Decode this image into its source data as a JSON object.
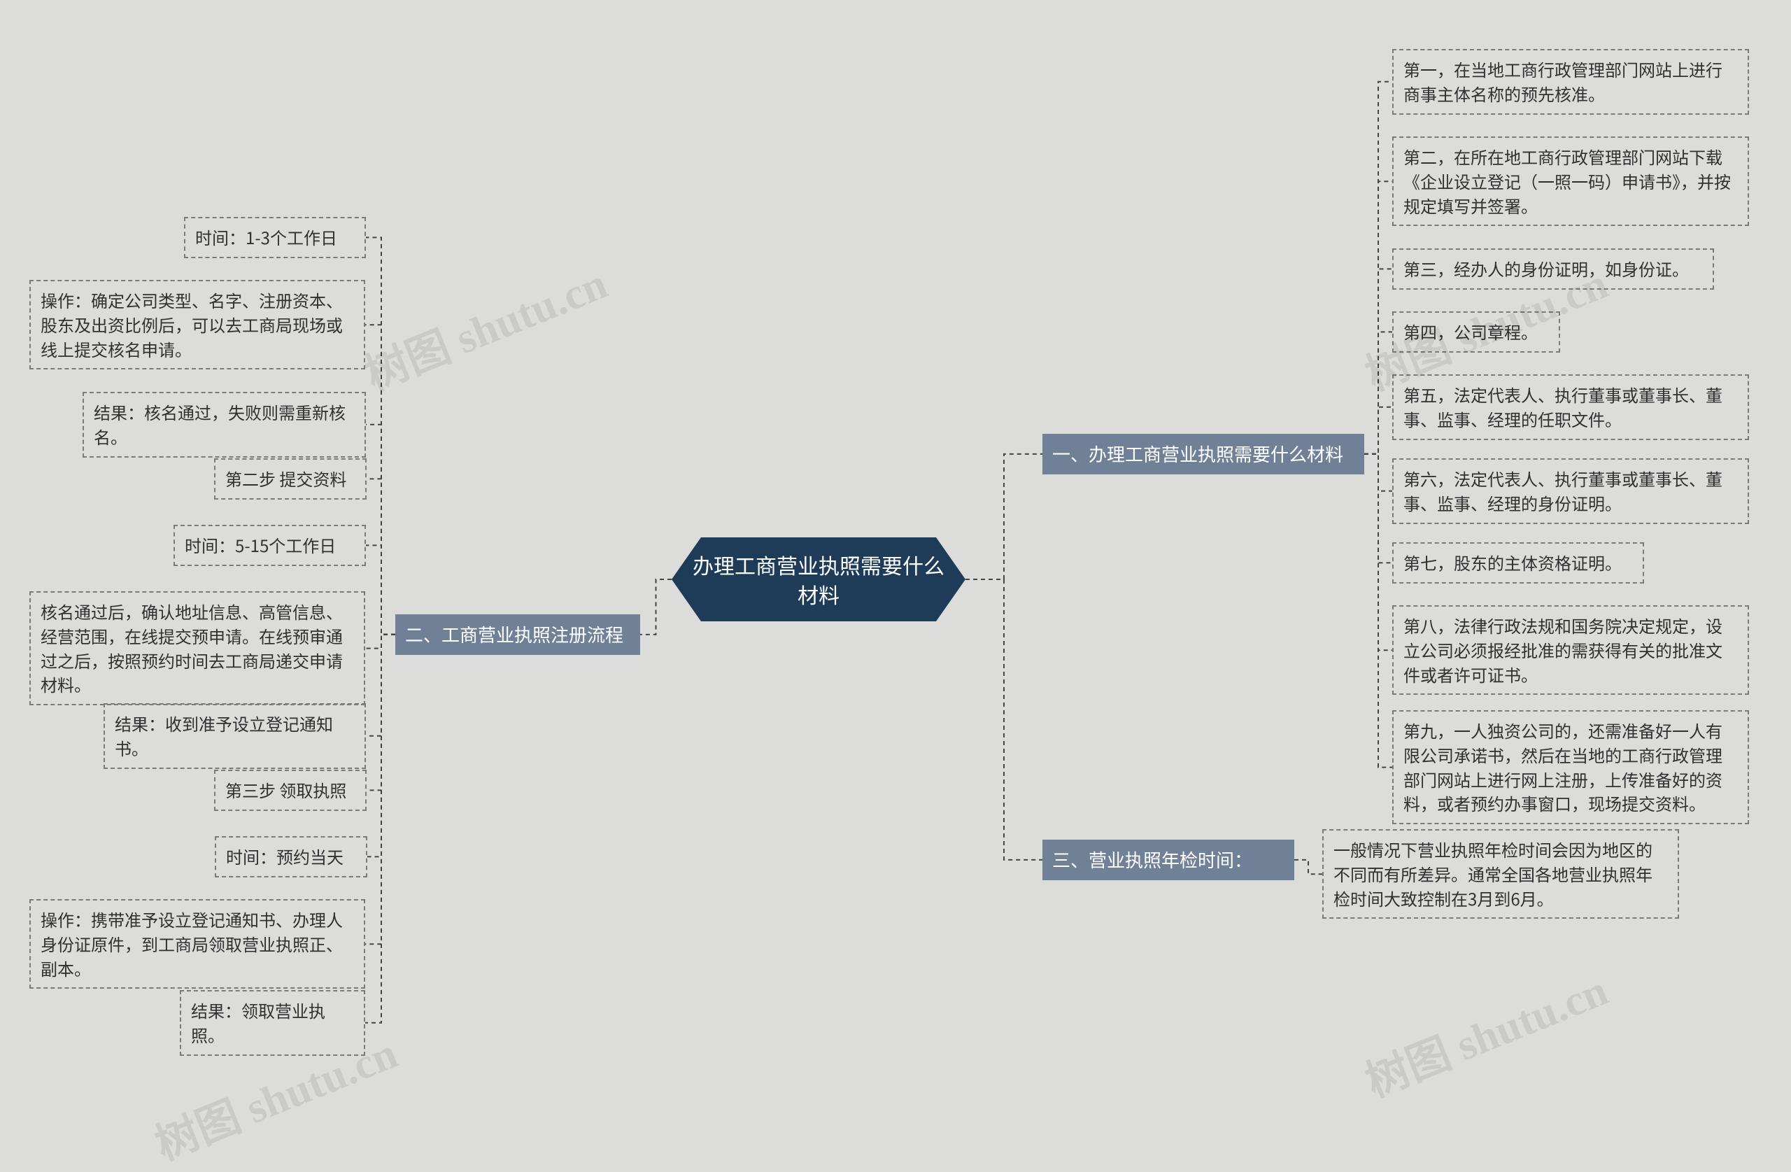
{
  "center": "办理工商营业执照需要什么材料",
  "branch1": {
    "title": "一、办理工商营业执照需要什么材料",
    "items": [
      "第一，在当地工商行政管理部门网站上进行商事主体名称的预先核准。",
      "第二，在所在地工商行政管理部门网站下载《企业设立登记（一照一码）申请书》，并按规定填写并签署。",
      "第三，经办人的身份证明，如身份证。",
      "第四，公司章程。",
      "第五，法定代表人、执行董事或董事长、董事、监事、经理的任职文件。",
      "第六，法定代表人、执行董事或董事长、董事、监事、经理的身份证明。",
      "第七，股东的主体资格证明。",
      "第八，法律行政法规和国务院决定规定，设立公司必须报经批准的需获得有关的批准文件或者许可证书。",
      "第九，一人独资公司的，还需准备好一人有限公司承诺书，然后在当地的工商行政管理部门网站上进行网上注册，上传准备好的资料，或者预约办事窗口，现场提交资料。"
    ]
  },
  "branch2": {
    "title": "二、工商营业执照注册流程",
    "items": [
      "时间：1-3个工作日",
      "操作：确定公司类型、名字、注册资本、股东及出资比例后，可以去工商局现场或线上提交核名申请。",
      "结果：核名通过，失败则需重新核名。",
      "第二步 提交资料",
      "时间：5-15个工作日",
      "核名通过后，确认地址信息、高管信息、经营范围，在线提交预申请。在线预审通过之后，按照预约时间去工商局递交申请材料。",
      "结果：收到准予设立登记通知书。",
      "第三步 领取执照",
      "时间：预约当天",
      "操作：携带准予设立登记通知书、办理人身份证原件，到工商局领取营业执照正、副本。",
      "结果：领取营业执照。"
    ]
  },
  "branch3": {
    "title": "三、营业执照年检时间：",
    "text": "一般情况下营业执照年检时间会因为地区的不同而有所差异。通常全国各地营业执照年检时间大致控制在3月到6月。"
  },
  "watermarks": [
    "树图 shutu.cn",
    "树图 shutu.cn",
    "树图 shutu.cn",
    "树图 shutu.cn"
  ],
  "chart_data": {
    "type": "mindmap",
    "root": "办理工商营业执照需要什么材料",
    "children": [
      {
        "label": "一、办理工商营业执照需要什么材料",
        "children": [
          {
            "label": "第一，在当地工商行政管理部门网站上进行商事主体名称的预先核准。"
          },
          {
            "label": "第二，在所在地工商行政管理部门网站下载《企业设立登记（一照一码）申请书》，并按规定填写并签署。"
          },
          {
            "label": "第三，经办人的身份证明，如身份证。"
          },
          {
            "label": "第四，公司章程。"
          },
          {
            "label": "第五，法定代表人、执行董事或董事长、董事、监事、经理的任职文件。"
          },
          {
            "label": "第六，法定代表人、执行董事或董事长、董事、监事、经理的身份证明。"
          },
          {
            "label": "第七，股东的主体资格证明。"
          },
          {
            "label": "第八，法律行政法规和国务院决定规定，设立公司必须报经批准的需获得有关的批准文件或者许可证书。"
          },
          {
            "label": "第九，一人独资公司的，还需准备好一人有限公司承诺书，然后在当地的工商行政管理部门网站上进行网上注册，上传准备好的资料，或者预约办事窗口，现场提交资料。"
          }
        ]
      },
      {
        "label": "二、工商营业执照注册流程",
        "children": [
          {
            "label": "时间：1-3个工作日"
          },
          {
            "label": "操作：确定公司类型、名字、注册资本、股东及出资比例后，可以去工商局现场或线上提交核名申请。"
          },
          {
            "label": "结果：核名通过，失败则需重新核名。"
          },
          {
            "label": "第二步 提交资料"
          },
          {
            "label": "时间：5-15个工作日"
          },
          {
            "label": "核名通过后，确认地址信息、高管信息、经营范围，在线提交预申请。在线预审通过之后，按照预约时间去工商局递交申请材料。"
          },
          {
            "label": "结果：收到准予设立登记通知书。"
          },
          {
            "label": "第三步 领取执照"
          },
          {
            "label": "时间：预约当天"
          },
          {
            "label": "操作：携带准予设立登记通知书、办理人身份证原件，到工商局领取营业执照正、副本。"
          },
          {
            "label": "结果：领取营业执照。"
          }
        ]
      },
      {
        "label": "三、营业执照年检时间：",
        "children": [
          {
            "label": "一般情况下营业执照年检时间会因为地区的不同而有所差异。通常全国各地营业执照年检时间大致控制在3月到6月。"
          }
        ]
      }
    ]
  }
}
